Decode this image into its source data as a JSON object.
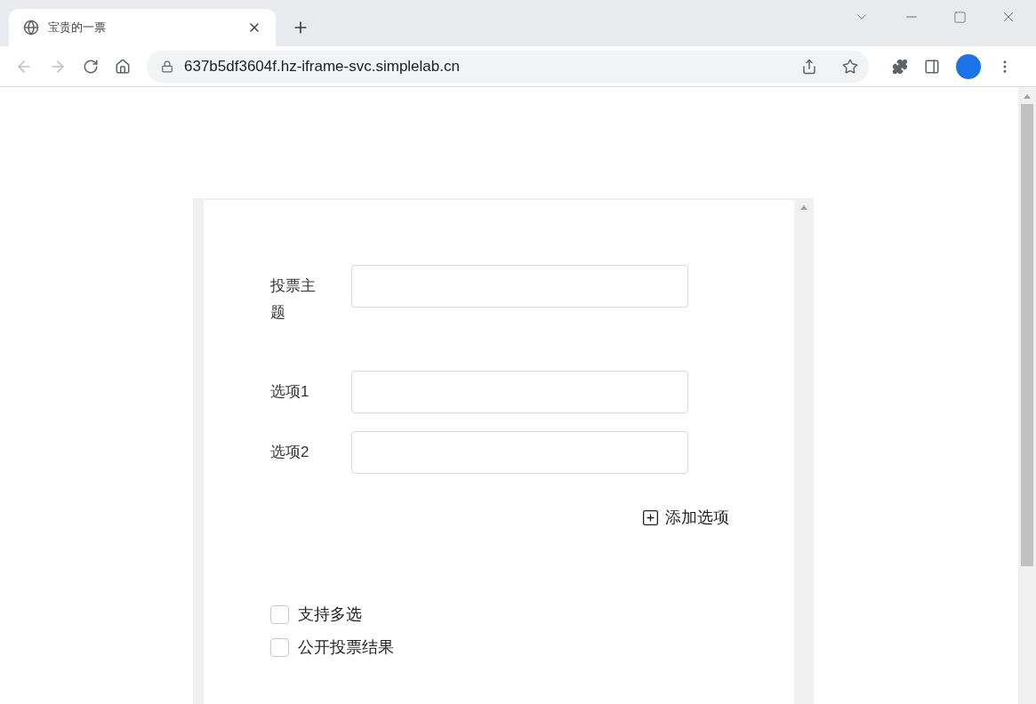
{
  "browser": {
    "tab": {
      "title": "宝贵的一票",
      "selected": true
    },
    "url": "637b5df3604f.hz-iframe-svc.simplelab.cn"
  },
  "form": {
    "fields": [
      {
        "label": "投票主题"
      },
      {
        "label": "选项1"
      },
      {
        "label": "选项2"
      }
    ],
    "add_option": "添加选项",
    "options": [
      {
        "label": "支持多选",
        "checked": false
      },
      {
        "label": "公开投票结果",
        "checked": false
      }
    ]
  }
}
